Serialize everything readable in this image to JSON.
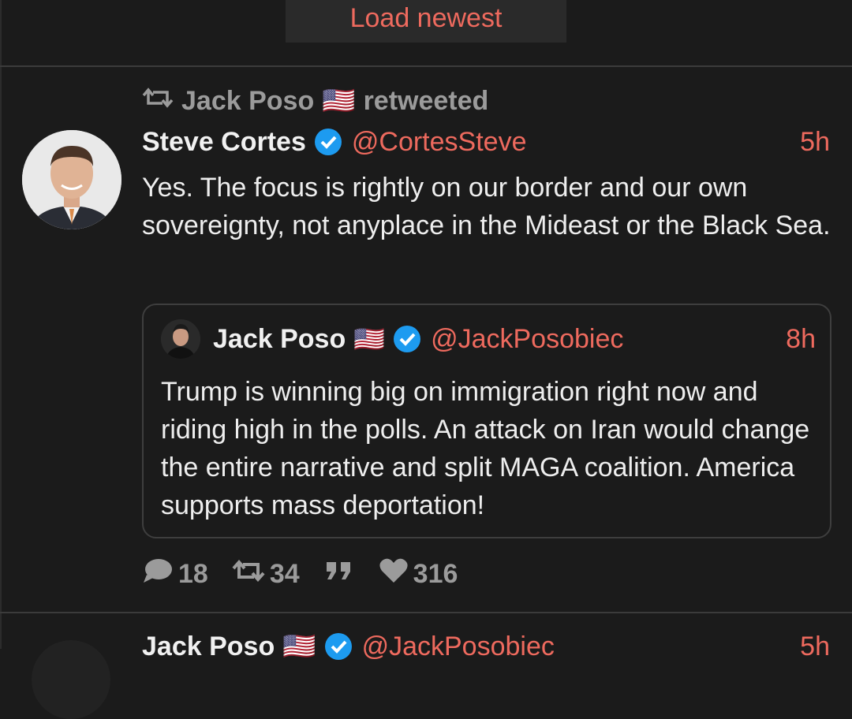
{
  "load_newest": {
    "label": "Load newest"
  },
  "retweet_banner": {
    "name": "Jack Poso",
    "flag": "🇺🇸",
    "suffix": "retweeted"
  },
  "tweet": {
    "author_name": "Steve Cortes",
    "handle": "@CortesSteve",
    "time": "5h",
    "text": "Yes. The focus is rightly on our border and our own sovereignty, not anyplace in the Mideast or the Black Sea.",
    "quoted": {
      "author_name": "Jack Poso",
      "flag": "🇺🇸",
      "handle": "@JackPosobiec",
      "time": "8h",
      "text": "Trump is winning big on immigration right now and riding high in the polls. An attack on Iran would change the entire narrative and split MAGA coalition. America supports mass deportation!"
    },
    "actions": {
      "replies": "18",
      "retweets": "34",
      "likes": "316"
    }
  },
  "next_tweet": {
    "author_name": "Jack Poso",
    "flag": "🇺🇸",
    "handle": "@JackPosobiec",
    "time": "5h"
  },
  "colors": {
    "accent": "#ee6a5e",
    "background": "#1b1b1b",
    "verified": "#1d9bf0",
    "muted": "#9b9b9b"
  },
  "icons": {
    "retweet": "retweet-icon",
    "verified": "verified-badge-icon",
    "reply": "reply-icon",
    "quote": "quote-icon",
    "like": "heart-icon"
  }
}
